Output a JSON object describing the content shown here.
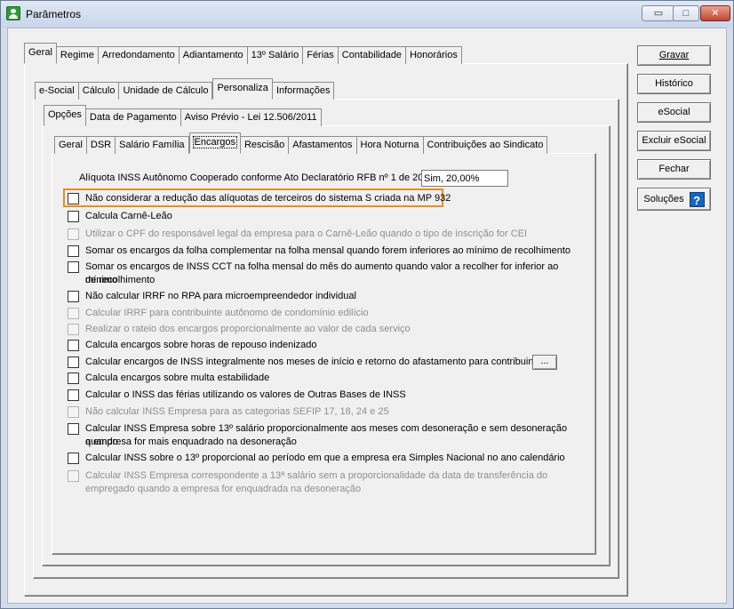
{
  "window": {
    "title": "Parâmetros",
    "minimize": "▭",
    "maximize": "□",
    "close": "✕"
  },
  "tabs_level1": [
    "Geral",
    "Regime",
    "Arredondamento",
    "Adiantamento",
    "13º Salário",
    "Férias",
    "Contabilidade",
    "Honorários"
  ],
  "tabs_level2": [
    "e-Social",
    "Cálculo",
    "Unidade de Cálculo",
    "Personaliza",
    "Informações"
  ],
  "tabs_level3": [
    "Opções",
    "Data de Pagamento",
    "Aviso Prévio - Lei 12.506/2011"
  ],
  "tabs_level4": [
    "Geral",
    "DSR",
    "Salário Família",
    "Encargos",
    "Rescisão",
    "Afastamentos",
    "Hora Noturna",
    "Contribuições ao Sindicato"
  ],
  "buttons": {
    "gravar": "Gravar",
    "historico": "Histórico",
    "esocial": "eSocial",
    "excluir_esocial": "Excluir eSocial",
    "fechar": "Fechar",
    "solucoes": "Soluções",
    "help": "?",
    "dots": "..."
  },
  "aliquota": {
    "label": "Alíquota INSS Autônomo Cooperado conforme Ato Declaratório RFB nº 1 de 2017:",
    "value": "Sim, 20,00%"
  },
  "options": [
    {
      "label": "Não considerar a redução das alíquotas de terceiros do sistema S criada na MP 932",
      "enabled": true
    },
    {
      "label": "Calcula Carnê-Leão",
      "enabled": true
    },
    {
      "label": "Utilizar o CPF do responsável legal da empresa para o Carnê-Leão quando o tipo de inscrição for CEI",
      "enabled": false
    },
    {
      "label": "Somar os encargos da folha complementar na folha mensal quando forem inferiores ao mínimo de recolhimento",
      "enabled": true
    },
    {
      "label": "Somar os encargos de INSS CCT na folha mensal do mês do aumento quando valor a recolher for inferior ao mínimo",
      "label2": "de recolhimento",
      "enabled": true
    },
    {
      "label": "Não calcular IRRF no RPA para microempreendedor individual",
      "enabled": true
    },
    {
      "label": "Calcular IRRF para contribuinte autônomo de condomínio edilício",
      "enabled": false
    },
    {
      "label": "Realizar o rateio dos encargos proporcionalmente ao valor de cada serviço",
      "enabled": false
    },
    {
      "label": "Calcula encargos sobre horas de repouso indenizado",
      "enabled": true
    },
    {
      "label": "Calcular encargos de INSS integralmente nos meses de início e retorno do afastamento para contribuintes",
      "enabled": true
    },
    {
      "label": "Calcula encargos sobre multa estabilidade",
      "enabled": true
    },
    {
      "label": "Calcular o INSS das férias utilizando os valores de Outras Bases de INSS",
      "enabled": true
    },
    {
      "label": "Não calcular INSS Empresa para as categorias SEFIP 17, 18, 24 e 25",
      "enabled": false
    },
    {
      "label": "Calcular INSS Empresa sobre 13º salário proporcionalmente aos meses com desoneração e sem desoneração quando",
      "label2": "a empresa for mais enquadrado na desoneração",
      "enabled": true
    },
    {
      "label": "Calcular INSS sobre o 13º proporcional ao período em que a empresa era Simples Nacional no ano calendário",
      "enabled": true
    },
    {
      "label": "Calcular INSS Empresa correspondente a 13ª salário sem a proporcionalidade da data de transferência do",
      "label2": "empregado quando a empresa for enquadrada na desoneração",
      "enabled": false
    }
  ]
}
